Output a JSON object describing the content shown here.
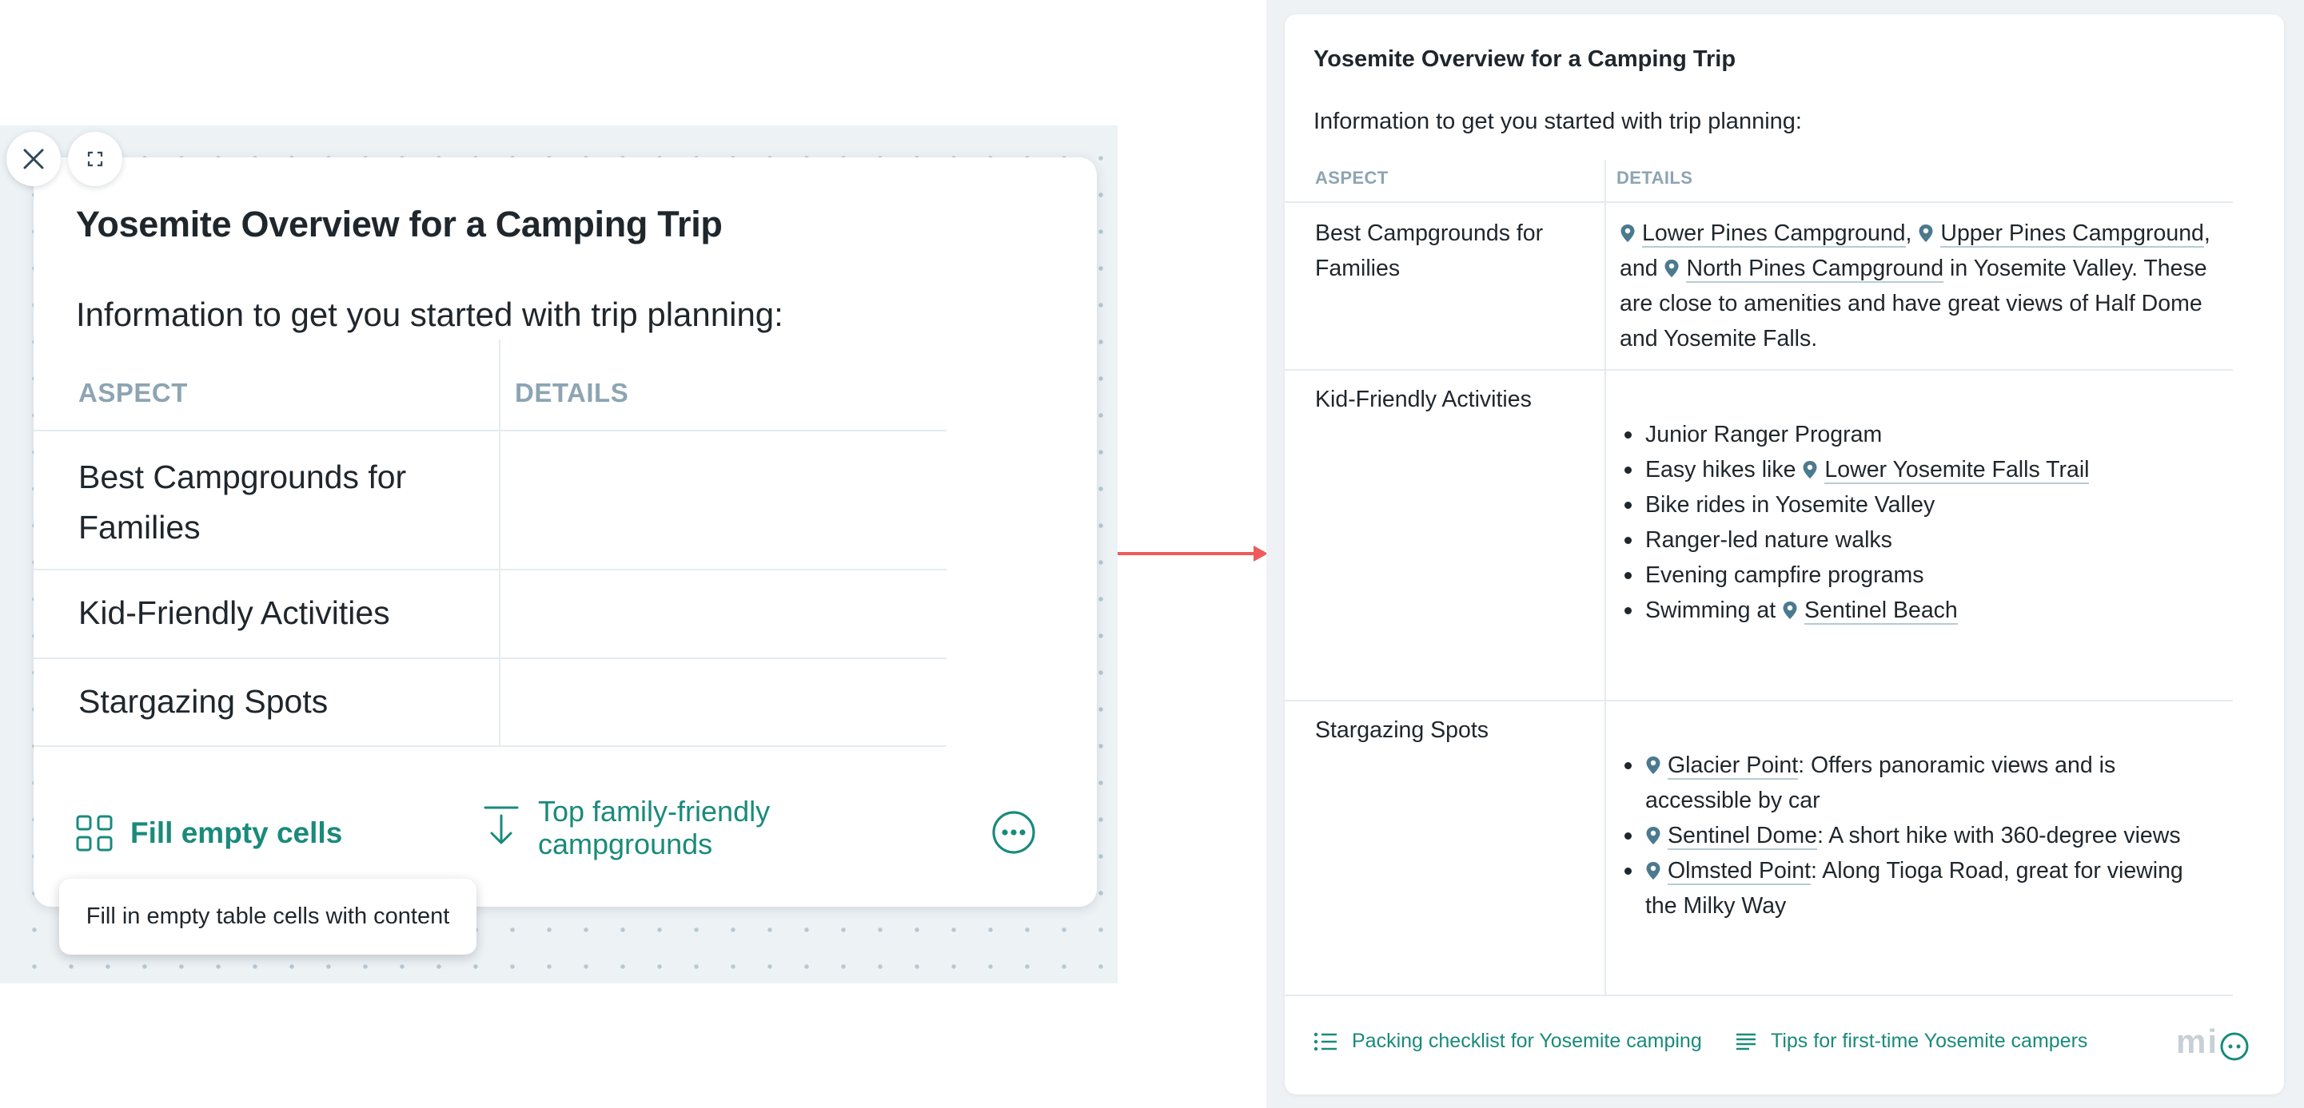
{
  "left_card": {
    "title": "Yosemite Overview for a Camping Trip",
    "intro": "Information to get you started with trip planning:",
    "table": {
      "headers": [
        "ASPECT",
        "DETAILS"
      ],
      "rows": [
        {
          "aspect": "Best Campgrounds for Families",
          "details": ""
        },
        {
          "aspect": "Kid-Friendly Activities",
          "details": ""
        },
        {
          "aspect": "Stargazing Spots",
          "details": ""
        }
      ]
    },
    "actions": {
      "fill_label": "Fill empty cells",
      "top_family_label": "Top family-friendly campgrounds"
    },
    "tooltip": "Fill in empty table cells with content"
  },
  "right_panel": {
    "title": "Yosemite Overview for a Camping Trip",
    "intro": "Information to get you started with trip planning:",
    "headers": [
      "ASPECT",
      "DETAILS"
    ],
    "row1": {
      "aspect": "Best Campgrounds for Families",
      "place1": "Lower Pines Campground",
      "place2": "Upper Pines Campground",
      "sep1": ",",
      "and": "and",
      "place3": "North Pines Campground",
      "text": "in Yosemite Valley. These are close to amenities and have great views of Half Dome and Yosemite Falls."
    },
    "row2": {
      "aspect": "Kid-Friendly Activities",
      "item1": "Junior Ranger Program",
      "item2_prefix": "Easy hikes like",
      "item2_place": "Lower Yosemite Falls Trail",
      "item3": "Bike rides in Yosemite Valley",
      "item4": "Ranger-led nature walks",
      "item5": "Evening campfire programs",
      "item6_prefix": "Swimming at",
      "item6_place": "Sentinel Beach"
    },
    "row3": {
      "aspect": "Stargazing Spots",
      "item1_place": "Glacier Point",
      "item1_text": ": Offers panoramic views and is accessible by car",
      "item2_place": "Sentinel Dome",
      "item2_text": ": A short hike with 360-degree views",
      "item3_place": "Olmsted Point",
      "item3_text": ": Along Tioga Road, great for viewing the Milky Way"
    },
    "footer": {
      "packing_label": "Packing checklist for Yosemite camping",
      "tips_label": "Tips for first-time Yosemite campers"
    },
    "logo_text": "mi"
  },
  "colors": {
    "accent": "#1a8a7c",
    "header_text": "#8da4b3",
    "connector": "#f05a5a",
    "pin": "#4b7a8e"
  },
  "icons": [
    "close-icon",
    "expand-icon",
    "grid-icon",
    "insert-below-icon",
    "more-icon",
    "map-pin-icon",
    "list-icon",
    "text-lines-icon",
    "assistant-bot-icon"
  ]
}
